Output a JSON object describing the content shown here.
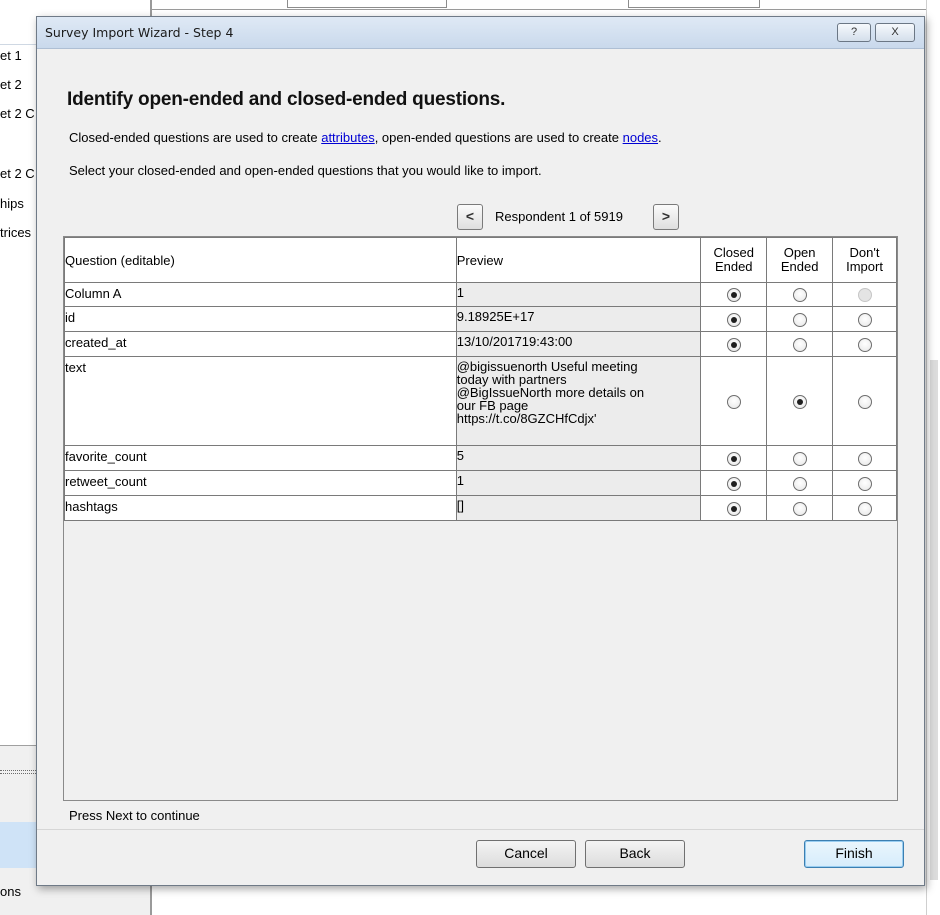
{
  "background": {
    "left_items": [
      "et 1",
      "et 2",
      "et 2 C",
      "et 2 C",
      "hips",
      "trices"
    ],
    "bottom_item": "ons"
  },
  "dialog": {
    "title": "Survey Import Wizard - Step 4",
    "help_glyph": "?",
    "close_glyph": "X",
    "heading": "Identify open-ended and closed-ended questions.",
    "desc1_pre": "Closed-ended questions are used to create ",
    "desc1_link1": "attributes",
    "desc1_mid": ", open-ended questions are used to create ",
    "desc1_link2": "nodes",
    "desc1_post": ".",
    "desc2": "Select your closed-ended and open-ended questions that you would like to import.",
    "nav": {
      "prev_icon": "<",
      "label": "Respondent 1 of 5919",
      "next_icon": ">"
    },
    "columns": {
      "question": "Question (editable)",
      "preview": "Preview",
      "closed_l1": "Closed",
      "closed_l2": "Ended",
      "open_l1": "Open",
      "open_l2": "Ended",
      "dont_l1": "Don't",
      "dont_l2": "Import"
    },
    "rows": [
      {
        "question": "Column A",
        "preview": "1",
        "selected": "closed",
        "dont_disabled": true
      },
      {
        "question": "id",
        "preview": "9.18925E+17",
        "selected": "closed"
      },
      {
        "question": "created_at",
        "preview": "13/10/201719:43:00",
        "selected": "closed"
      },
      {
        "question": "text",
        "preview_lines": [
          "@bigissuenorth Useful meeting",
          "today with partners",
          "@BigIssueNorth more details on",
          "our FB page",
          "https://t.co/8GZCHfCdjx'"
        ],
        "selected": "open"
      },
      {
        "question": "favorite_count",
        "preview": "5",
        "selected": "closed"
      },
      {
        "question": "retweet_count",
        "preview": "1",
        "selected": "closed"
      },
      {
        "question": "hashtags",
        "preview": "[]",
        "selected": "closed"
      }
    ],
    "status": "Press Next to continue",
    "buttons": {
      "cancel": "Cancel",
      "back": "Back",
      "finish": "Finish"
    }
  }
}
